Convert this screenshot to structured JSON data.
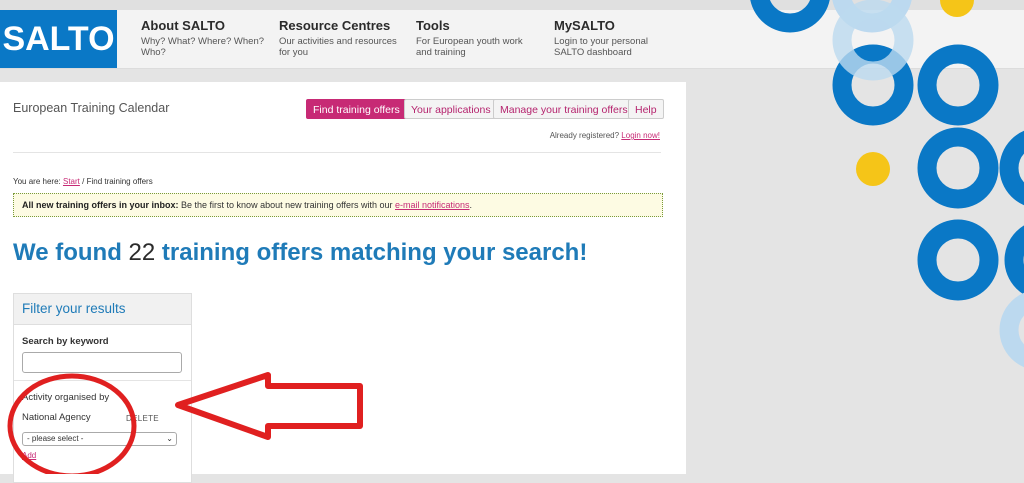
{
  "header": {
    "logo_text": "SALTO",
    "nav": [
      {
        "title": "About SALTO",
        "desc": "Why? What? Where? When? Who?"
      },
      {
        "title": "Resource Centres",
        "desc": "Our activities and resources for you"
      },
      {
        "title": "Tools",
        "desc": "For European youth work and training"
      },
      {
        "title": "MySALTO",
        "desc": "Login to your personal SALTO dashboard"
      }
    ]
  },
  "app": {
    "title": "European Training Calendar",
    "buttons": {
      "find": "Find training offers",
      "applications": "Your applications",
      "manage": "Manage your training offers",
      "help": "Help"
    },
    "login_prefix": "Already registered?",
    "login_link": "Login now!"
  },
  "breadcrumb": {
    "prefix": "You are here:",
    "start": "Start",
    "sep": "/",
    "current": "Find training offers"
  },
  "notice": {
    "bold": "All new training offers in your inbox:",
    "text": "Be the first to know about new training offers with our",
    "link": "e-mail notifications",
    "end": "."
  },
  "results": {
    "prefix": "We found",
    "count": "22",
    "suffix": "training offers matching your search!"
  },
  "filter": {
    "title": "Filter your results",
    "keyword_label": "Search by keyword",
    "keyword_value": "",
    "organised_label": "Activity organised by",
    "organised_value": "National Agency",
    "delete": "DELETE",
    "select_value": "- please select -",
    "add": "Add"
  },
  "colors": {
    "brand_blue": "#0a78c6",
    "accent_pink": "#c72a75",
    "headline_blue": "#1f7bb8",
    "annotation_red": "#e02020",
    "deco_yellow": "#f5c518"
  }
}
